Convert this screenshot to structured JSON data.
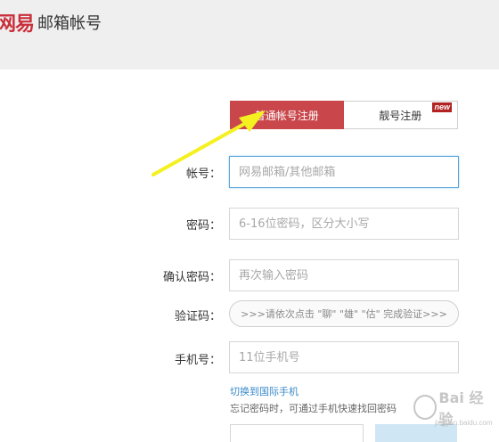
{
  "header": {
    "logo_mark": "网易",
    "title": "邮箱帐号"
  },
  "tabs": [
    {
      "label": "普通帐号注册",
      "active": true
    },
    {
      "label": "靓号注册",
      "badge": "new",
      "active": false
    }
  ],
  "form": {
    "account": {
      "label": "帐号：",
      "placeholder": "网易邮箱/其他邮箱"
    },
    "password": {
      "label": "密码：",
      "placeholder": "6-16位密码，区分大小写"
    },
    "confirm": {
      "label": "确认密码：",
      "placeholder": "再次输入密码"
    },
    "captcha": {
      "label": "验证码：",
      "text": ">>>请依次点击 \"聊\" \"雄\" \"估\" 完成验证>>>"
    },
    "phone": {
      "label": "手机号：",
      "placeholder": "11位手机号"
    }
  },
  "links": {
    "intl_phone": "切换到国际手机"
  },
  "tip": "忘记密码时，可通过手机快速找回密码",
  "watermark": {
    "text": "Bai 经验",
    "url": "jingyan.baidu.com"
  },
  "colors": {
    "accent_red": "#c9474b",
    "link_blue": "#3a8ac8",
    "arrow_yellow": "#f5f020"
  },
  "icons": {
    "arrow": "arrow-annotation"
  }
}
